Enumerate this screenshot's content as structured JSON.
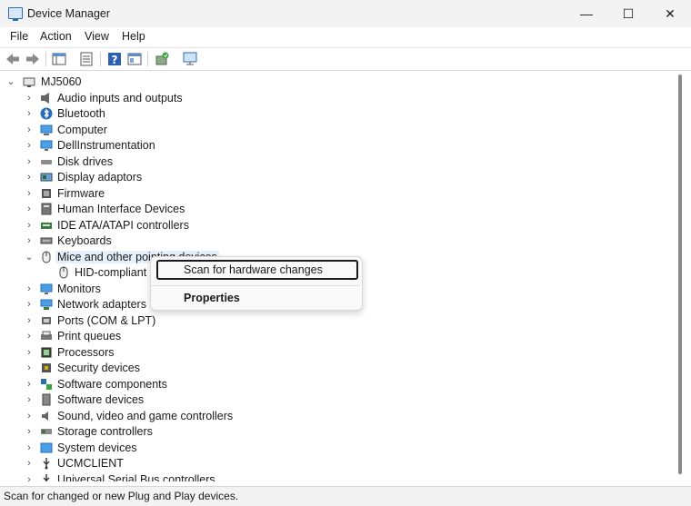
{
  "window": {
    "title": "Device Manager",
    "minimize": "—",
    "maximize": "☐",
    "close": "✕"
  },
  "menu": [
    "File",
    "Action",
    "View",
    "Help"
  ],
  "toolbar_icons": [
    "back-icon",
    "forward-icon",
    "show-hide-tree-icon",
    "properties-icon",
    "help-icon",
    "console-view-icon",
    "update-driver-icon",
    "scan-hardware-icon"
  ],
  "tree": {
    "root": "MJ5060",
    "items": [
      {
        "label": "Audio inputs and outputs",
        "icon": "speaker-icon",
        "expanded": false
      },
      {
        "label": "Bluetooth",
        "icon": "bluetooth-icon",
        "expanded": false
      },
      {
        "label": "Computer",
        "icon": "computer-icon",
        "expanded": false
      },
      {
        "label": "DellInstrumentation",
        "icon": "monitor-icon",
        "expanded": false
      },
      {
        "label": "Disk drives",
        "icon": "disk-icon",
        "expanded": false
      },
      {
        "label": "Display adaptors",
        "icon": "display-adapter-icon",
        "expanded": false
      },
      {
        "label": "Firmware",
        "icon": "firmware-icon",
        "expanded": false
      },
      {
        "label": "Human Interface Devices",
        "icon": "hid-icon",
        "expanded": false
      },
      {
        "label": "IDE ATA/ATAPI controllers",
        "icon": "ide-icon",
        "expanded": false
      },
      {
        "label": "Keyboards",
        "icon": "keyboard-icon",
        "expanded": false
      },
      {
        "label": "Mice and other pointing devices",
        "icon": "mouse-icon",
        "expanded": true,
        "selected": true
      },
      {
        "label": "HID-compliant m",
        "icon": "mouse-icon",
        "child": true
      },
      {
        "label": "Monitors",
        "icon": "monitor-icon",
        "expanded": false
      },
      {
        "label": "Network adapters",
        "icon": "network-icon",
        "expanded": false
      },
      {
        "label": "Ports (COM & LPT)",
        "icon": "port-icon",
        "expanded": false
      },
      {
        "label": "Print queues",
        "icon": "printer-icon",
        "expanded": false
      },
      {
        "label": "Processors",
        "icon": "processor-icon",
        "expanded": false
      },
      {
        "label": "Security devices",
        "icon": "security-icon",
        "expanded": false
      },
      {
        "label": "Software components",
        "icon": "software-components-icon",
        "expanded": false
      },
      {
        "label": "Software devices",
        "icon": "software-device-icon",
        "expanded": false
      },
      {
        "label": "Sound, video and game controllers",
        "icon": "sound-icon",
        "expanded": false
      },
      {
        "label": "Storage controllers",
        "icon": "storage-icon",
        "expanded": false
      },
      {
        "label": "System devices",
        "icon": "system-icon",
        "expanded": false
      },
      {
        "label": "UCMCLIENT",
        "icon": "usb-icon",
        "expanded": false
      },
      {
        "label": "Universal Serial Bus controllers",
        "icon": "usb-icon",
        "expanded": false
      }
    ]
  },
  "context_menu": {
    "items": [
      {
        "label": "Scan for hardware changes",
        "focused": true
      },
      {
        "label": "Properties",
        "bold": true
      }
    ]
  },
  "status": "Scan for changed or new Plug and Play devices.",
  "colors": {
    "selection": "#e5f0fb",
    "chrome": "#f3f3f3",
    "accent": "#2b6cb8"
  }
}
